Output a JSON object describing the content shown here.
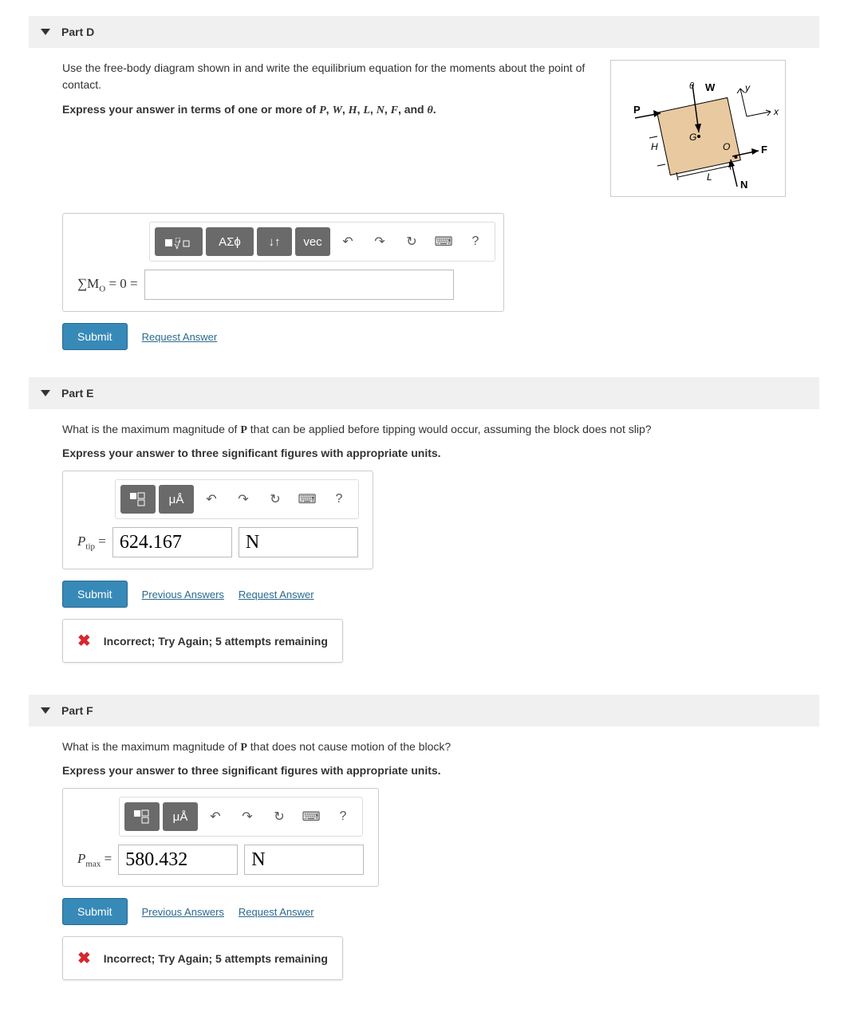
{
  "partD": {
    "title": "Part D",
    "prompt": "Use the free-body diagram shown in and write the equilibrium equation for the moments about the point of contact.",
    "instruction_prefix": "Express your answer in terms of one or more of ",
    "vars": [
      "P",
      "W",
      "H",
      "L",
      "N",
      "F"
    ],
    "instruction_connector": ", and ",
    "theta": "θ",
    "instruction_suffix": ".",
    "eq_label": "∑M",
    "eq_sub": "O",
    "eq_rhs": " = 0 =",
    "input_value": "",
    "toolbar": {
      "templates": "□√□",
      "greek": "ΑΣϕ",
      "arrows": "↓↑",
      "vec": "vec"
    },
    "submit": "Submit",
    "request": "Request Answer",
    "diagram": {
      "y": "y",
      "x": "x",
      "W": "W",
      "P": "P",
      "G": "G",
      "O": "O",
      "F": "F",
      "H": "H",
      "L": "L",
      "N": "N",
      "theta": "θ"
    }
  },
  "partE": {
    "title": "Part E",
    "prompt_pre": "What is the maximum magnitude of ",
    "prompt_var": "P",
    "prompt_post": " that can be applied before tipping would occur, assuming the block does not slip?",
    "instruction": "Express your answer to three significant figures with appropriate units.",
    "label_base": "P",
    "label_sub": "tip",
    "label_eq": " =",
    "value": "624.167",
    "unit": "N",
    "toolbar": {
      "templates": "□/□",
      "units": "μÅ"
    },
    "submit": "Submit",
    "previous": "Previous Answers",
    "request": "Request Answer",
    "feedback": "Incorrect; Try Again; 5 attempts remaining"
  },
  "partF": {
    "title": "Part F",
    "prompt_pre": "What is the maximum magnitude of ",
    "prompt_var": "P",
    "prompt_post": " that does not cause motion of the block?",
    "instruction": "Express your answer to three significant figures with appropriate units.",
    "label_base": "P",
    "label_sub": "max",
    "label_eq": " =",
    "value": "580.432",
    "unit": "N",
    "toolbar": {
      "templates": "□/□",
      "units": "μÅ"
    },
    "submit": "Submit",
    "previous": "Previous Answers",
    "request": "Request Answer",
    "feedback": "Incorrect; Try Again; 5 attempts remaining"
  },
  "icons": {
    "undo": "↶",
    "redo": "↷",
    "reset": "↻",
    "keyboard": "⌨",
    "help": "?"
  }
}
